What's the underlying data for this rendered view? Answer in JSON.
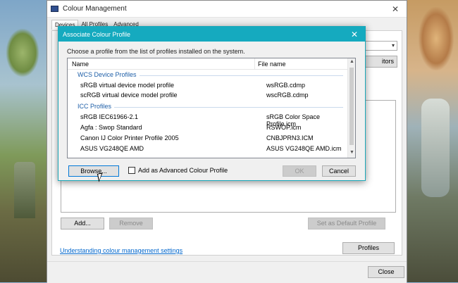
{
  "main_window": {
    "title": "Colour Management",
    "close_glyph": "✕",
    "tabs": [
      "Devices",
      "All Profiles",
      "Advanced"
    ],
    "compare_label": "itors",
    "add_label": "Add...",
    "remove_label": "Remove",
    "set_default_label": "Set as Default Profile",
    "understanding_link": "Understanding colour management settings",
    "profiles_label": "Profiles",
    "close_label": "Close"
  },
  "dialog": {
    "title": "Associate Colour Profile",
    "close_glyph": "✕",
    "instruction": "Choose a profile from the list of profiles installed on the system.",
    "columns": {
      "name": "Name",
      "file": "File name"
    },
    "groups": [
      {
        "label": "WCS Device Profiles",
        "rows": [
          {
            "name": "sRGB virtual device model profile",
            "file": "wsRGB.cdmp"
          },
          {
            "name": "scRGB virtual device model profile",
            "file": "wscRGB.cdmp"
          }
        ]
      },
      {
        "label": "ICC Profiles",
        "rows": [
          {
            "name": "sRGB IEC61966-2.1",
            "file": "sRGB Color Space Profile.icm"
          },
          {
            "name": "Agfa : Swop Standard",
            "file": "RSWOP.icm"
          },
          {
            "name": "Canon IJ Color Printer Profile 2005",
            "file": "CNBJPRN3.ICM"
          },
          {
            "name": "ASUS VG248QE AMD",
            "file": "ASUS VG248QE AMD.icm"
          }
        ]
      }
    ],
    "browse_label": "Browse...",
    "advanced_checkbox_label": "Add as Advanced Colour Profile",
    "advanced_checked": false,
    "ok_label": "OK",
    "cancel_label": "Cancel"
  },
  "colors": {
    "dialog_titlebar": "#15aabf",
    "link": "#0066cc",
    "group_header": "#1e5fa8"
  }
}
